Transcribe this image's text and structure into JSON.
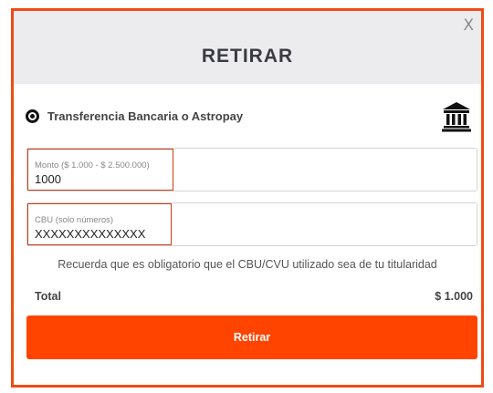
{
  "modal": {
    "close_label": "X",
    "title": "RETIRAR",
    "accent_color": "#ff4400",
    "border_color": "#f04a17"
  },
  "payment_method": {
    "label": "Transferencia Bancaria o Astropay",
    "selected": true,
    "icon": "bank-icon"
  },
  "amount_field": {
    "label": "Monto ($ 1.000 - $ 2.500.000)",
    "value": "1000"
  },
  "cbu_field": {
    "label": "CBU (solo números)",
    "value": "XXXXXXXXXXXXXX"
  },
  "notice": "Recuerda que es obligatorio que el CBU/CVU utilizado sea de tu titularidad",
  "total": {
    "label": "Total",
    "value": "$ 1.000"
  },
  "submit_label": "Retirar"
}
